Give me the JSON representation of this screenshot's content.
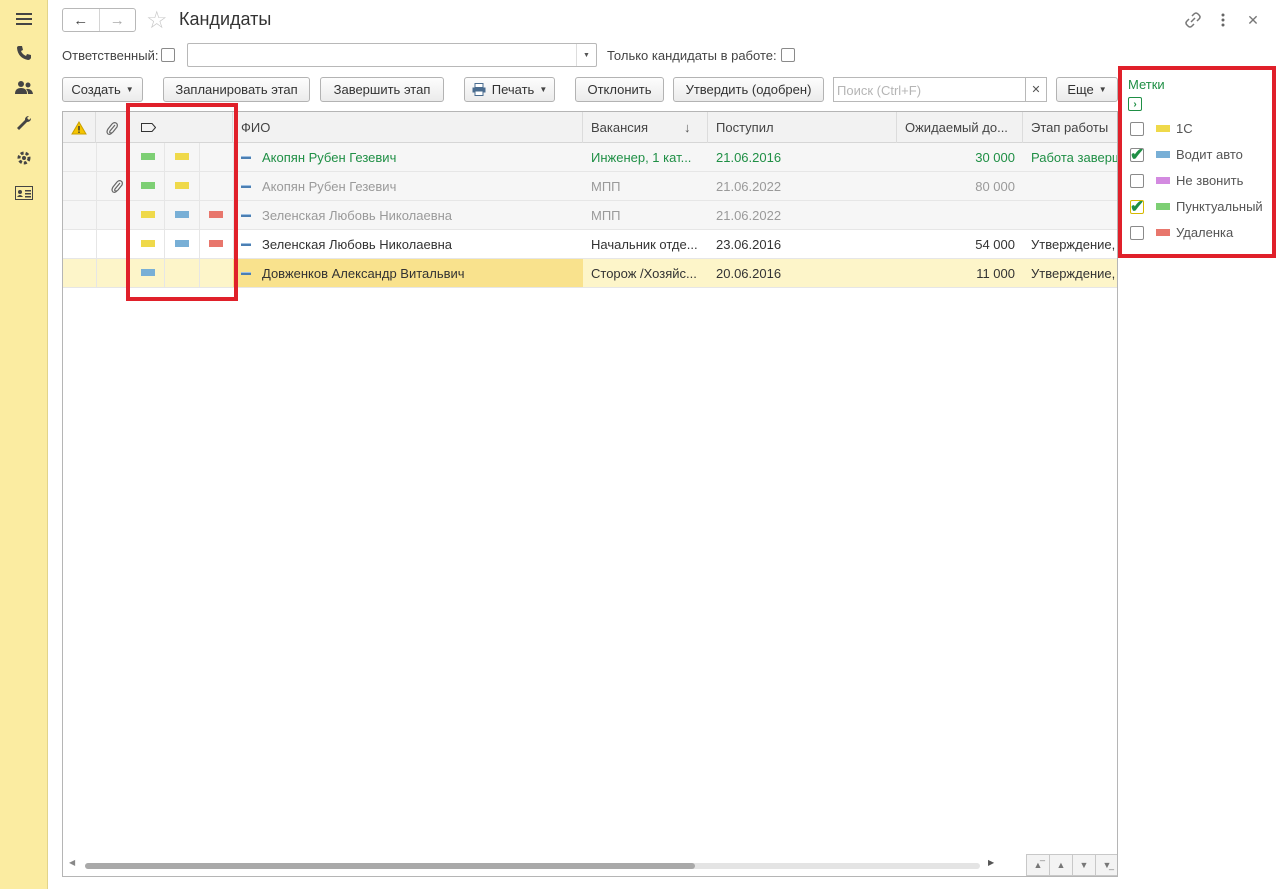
{
  "title": "Кандидаты",
  "filters": {
    "responsible_label": "Ответственный:",
    "only_active_label": "Только кандидаты в работе:"
  },
  "toolbar": {
    "create": "Создать",
    "plan_stage": "Запланировать этап",
    "finish_stage": "Завершить этап",
    "print": "Печать",
    "reject": "Отклонить",
    "approve": "Утвердить (одобрен)",
    "search_placeholder": "Поиск (Ctrl+F)",
    "more": "Еще"
  },
  "columns": {
    "fio": "ФИО",
    "vacancy": "Вакансия",
    "received": "Поступил",
    "expected": "Ожидаемый до...",
    "stage": "Этап работы"
  },
  "rows": [
    {
      "fio": "Акопян Рубен Гезевич",
      "vacancy": "Инженер, 1 кат...",
      "received": "21.06.2016",
      "expected": "30 000",
      "stage": "Работа заверш",
      "tags": [
        "green",
        "yellow"
      ],
      "attach": false,
      "style": "green"
    },
    {
      "fio": "Акопян Рубен Гезевич",
      "vacancy": "МПП",
      "received": "21.06.2022",
      "expected": "80 000",
      "stage": "",
      "tags": [
        "green",
        "yellow"
      ],
      "attach": true,
      "style": "grey"
    },
    {
      "fio": "Зеленская Любовь Николаевна",
      "vacancy": "МПП",
      "received": "21.06.2022",
      "expected": "",
      "stage": "",
      "tags": [
        "yellow",
        "blue",
        "red"
      ],
      "attach": false,
      "style": "grey"
    },
    {
      "fio": "Зеленская Любовь Николаевна",
      "vacancy": "Начальник отде...",
      "received": "23.06.2016",
      "expected": "54 000",
      "stage": "Утверждение,",
      "tags": [
        "yellow",
        "blue",
        "red"
      ],
      "attach": false,
      "style": "normal"
    },
    {
      "fio": "Довженков Александр Витальвич",
      "vacancy": "Сторож /Хозяйс...",
      "received": "20.06.2016",
      "expected": "11 000",
      "stage": "Утверждение,",
      "tags": [
        "blue"
      ],
      "attach": false,
      "style": "normal"
    }
  ],
  "tags_panel": {
    "title": "Метки",
    "items": [
      {
        "label": "1С",
        "color": "yellow",
        "checked": false
      },
      {
        "label": "Водит авто",
        "color": "blue",
        "checked": true
      },
      {
        "label": "Не звонить",
        "color": "violet",
        "checked": false
      },
      {
        "label": "Пунктуальный",
        "color": "green",
        "checked": true
      },
      {
        "label": "Удаленка",
        "color": "red",
        "checked": false
      }
    ]
  },
  "colors": {
    "green": "#7dcf74",
    "yellow": "#efd94a",
    "blue": "#78afd6",
    "red": "#e8766c",
    "violet": "#d38ae0",
    "green_text": "#1f8f45",
    "grey_text": "#9a9a9a",
    "highlight": "#e0202a"
  }
}
